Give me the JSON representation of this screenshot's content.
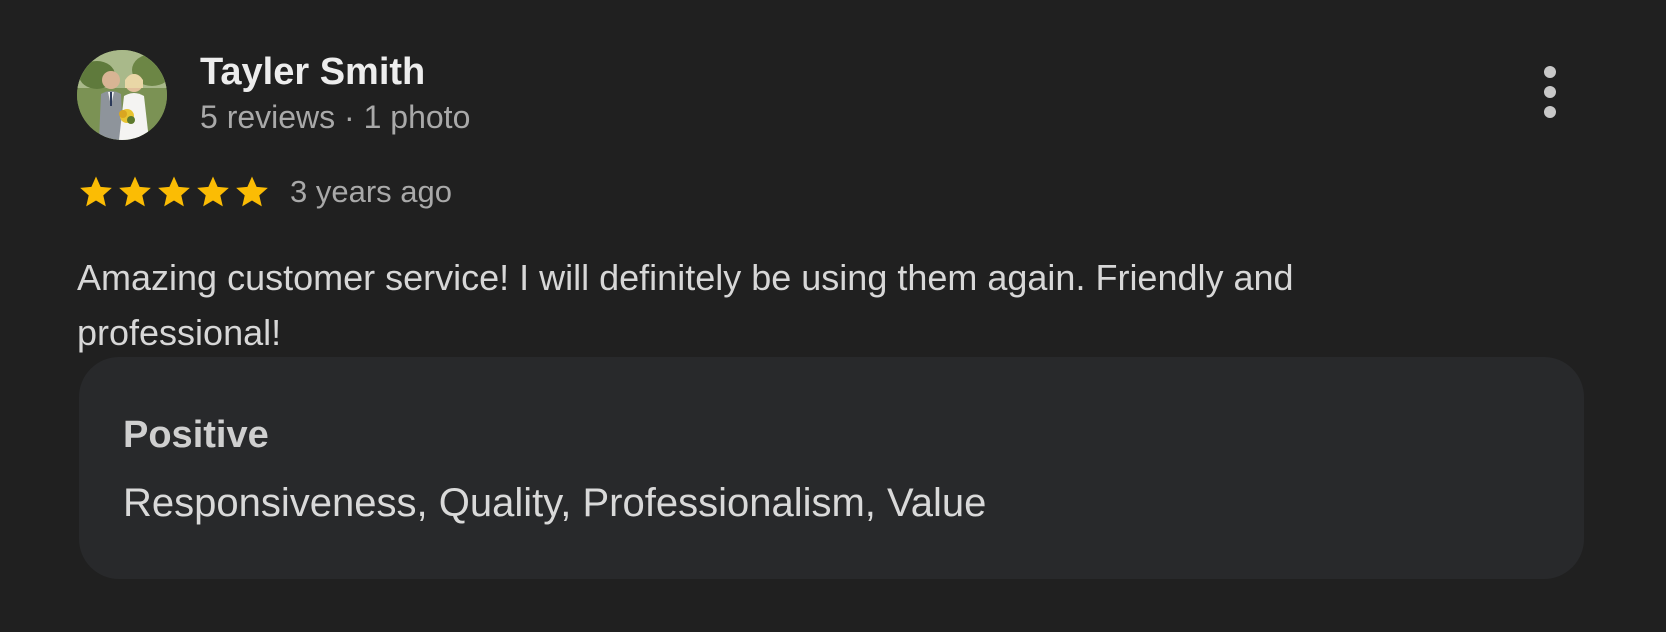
{
  "reviewer": {
    "name": "Tayler Smith",
    "meta": "5 reviews · 1 photo"
  },
  "rating": {
    "stars": 5,
    "max": 5,
    "date": "3 years ago",
    "star_color": "#FBBC04"
  },
  "review": {
    "text": "Amazing customer service! I will definitely be using them again. Friendly and professional!"
  },
  "highlights": {
    "title": "Positive",
    "values": "Responsiveness, Quality, Professionalism, Value"
  },
  "icons": {
    "more": "more-vert-icon",
    "star": "star-icon"
  }
}
